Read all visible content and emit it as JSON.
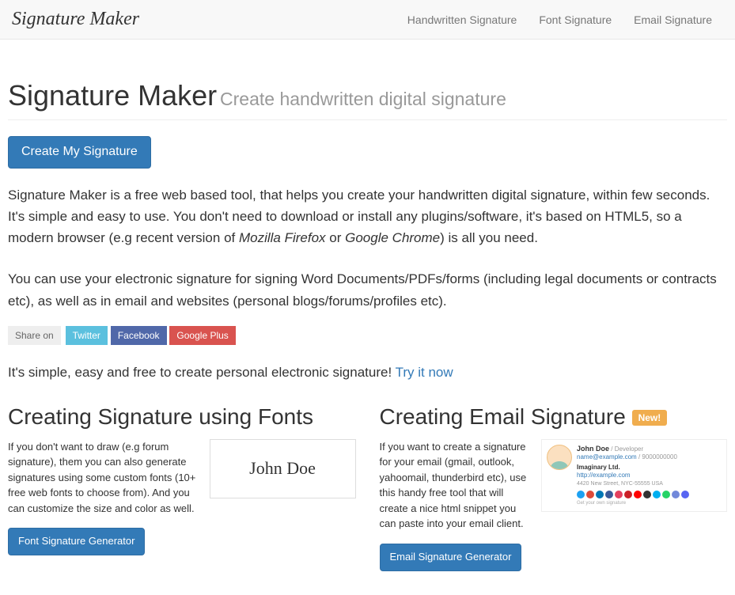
{
  "nav": {
    "brand": "Signature Maker",
    "links": [
      {
        "label": "Handwritten Signature"
      },
      {
        "label": "Font Signature"
      },
      {
        "label": "Email Signature"
      }
    ]
  },
  "header": {
    "title": "Signature Maker",
    "subtitle": "Create handwritten digital signature"
  },
  "cta_main": "Create My Signature",
  "lead_part1": "Signature Maker is a free web based tool, that helps you create your handwritten digital signature, within few seconds. It's simple and easy to use. You don't need to download or install any plugins/software, it's based on HTML5, so a modern browser (e.g recent version of ",
  "lead_ital1": "Mozilla Firefox",
  "lead_mid": " or ",
  "lead_ital2": "Google Chrome",
  "lead_part2": ") is all you need.",
  "body2": "You can use your electronic signature for signing Word Documents/PDFs/forms (including legal documents or contracts etc), as well as in email and websites (personal blogs/forums/profiles etc).",
  "share": {
    "label": "Share on",
    "twitter": "Twitter",
    "facebook": "Facebook",
    "google": "Google Plus"
  },
  "tryit_text": "It's simple, easy and free to create personal electronic signature! ",
  "tryit_link": "Try it now",
  "fonts_section": {
    "heading": "Creating Signature using Fonts",
    "text": "If you don't want to draw (e.g forum signature), them you can also generate signatures using some custom fonts (10+ free web fonts to choose from). And you can customize the size and color as well.",
    "preview_name": "John Doe",
    "button": "Font Signature Generator"
  },
  "email_section": {
    "heading": "Creating Email Signature",
    "badge": "New!",
    "text": "If you want to create a signature for your email (gmail, outlook, yahoomail, thunderbird etc), use this handy free tool that will create a nice html snippet you can paste into your email client.",
    "preview": {
      "name": "John Doe",
      "role": "Developer",
      "email": "name@example.com",
      "phone": "9000000000",
      "company": "Imaginary Ltd.",
      "site": "http://example.com",
      "address": "4420 New Street, NYC-55555 USA",
      "tag": "Get your own signature"
    },
    "button": "Email Signature Generator"
  },
  "social_colors": [
    "#1da1f2",
    "#dd4b39",
    "#0077b5",
    "#3b5998",
    "#e4405f",
    "#cb2027",
    "#ff0000",
    "#333333",
    "#00aff0",
    "#25d366",
    "#7289da",
    "#5865f2"
  ]
}
